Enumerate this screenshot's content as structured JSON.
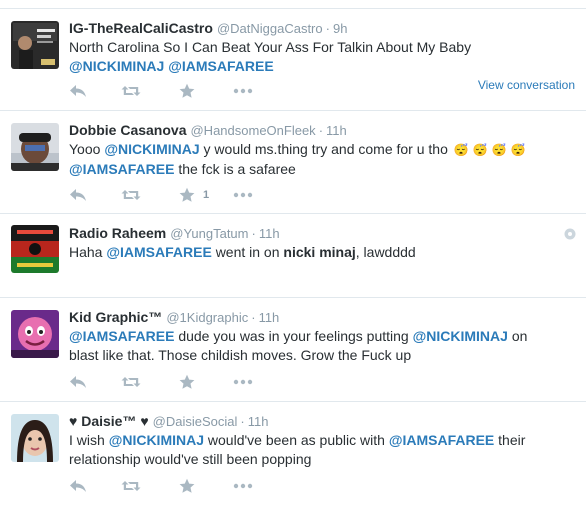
{
  "tweets": [
    {
      "fullname": "IG-TheRealCaliCastro",
      "username": "@DatNiggaCastro",
      "sep": "·",
      "time": "9h",
      "line1": "North Carolina So I Can Beat Your Ass For Talkin About My Baby",
      "mention1": "@NICKIMINAJ",
      "mention2": "@IAMSAFAREE",
      "view_conversation": "View conversation"
    },
    {
      "fullname": "Dobbie Casanova",
      "username": "@HandsomeOnFleek",
      "sep": "·",
      "time": "11h",
      "pre": "Yooo",
      "mention1": "@NICKIMINAJ",
      "mid": "y would ms.thing try and come for u tho",
      "emoji": [
        "😴",
        "😴",
        "😴",
        "😴"
      ],
      "mention2": "@IAMSAFAREE",
      "post": "the fck is a safaree",
      "retweet_count": "1"
    },
    {
      "fullname": "Radio Raheem",
      "username": "@YungTatum",
      "sep": "·",
      "time": "11h",
      "pre": "Haha",
      "mention1": "@IAMSAFAREE",
      "mid": "went in on",
      "bold": "nicki minaj",
      "post": ", lawdddd"
    },
    {
      "fullname": "Kid Graphic™",
      "username": "@1Kidgraphic",
      "sep": "·",
      "time": "11h",
      "mention1": "@IAMSAFAREE",
      "mid": "dude you was in your feelings putting",
      "mention2": "@NICKIMINAJ",
      "post": "on blast like that. Those childish moves. Grow the Fuck up"
    },
    {
      "fullname": "♥ Daisie™ ♥",
      "username": "@DaisieSocial",
      "sep": "·",
      "time": "11h",
      "pre": "I wish",
      "mention1": "@NICKIMINAJ",
      "mid": "would've been as public with",
      "mention2": "@IAMSAFAREE",
      "post": "their relationship would've still been popping"
    }
  ],
  "icons": {
    "reply": "reply-icon",
    "retweet": "retweet-icon",
    "favorite": "star-icon",
    "more": "more-icon",
    "settings": "gear-icon"
  },
  "colors": {
    "link": "#2b7bb9",
    "muted": "#8899a6",
    "action": "#aab8c2",
    "text": "#292f33",
    "divider": "#e1e8ed"
  }
}
